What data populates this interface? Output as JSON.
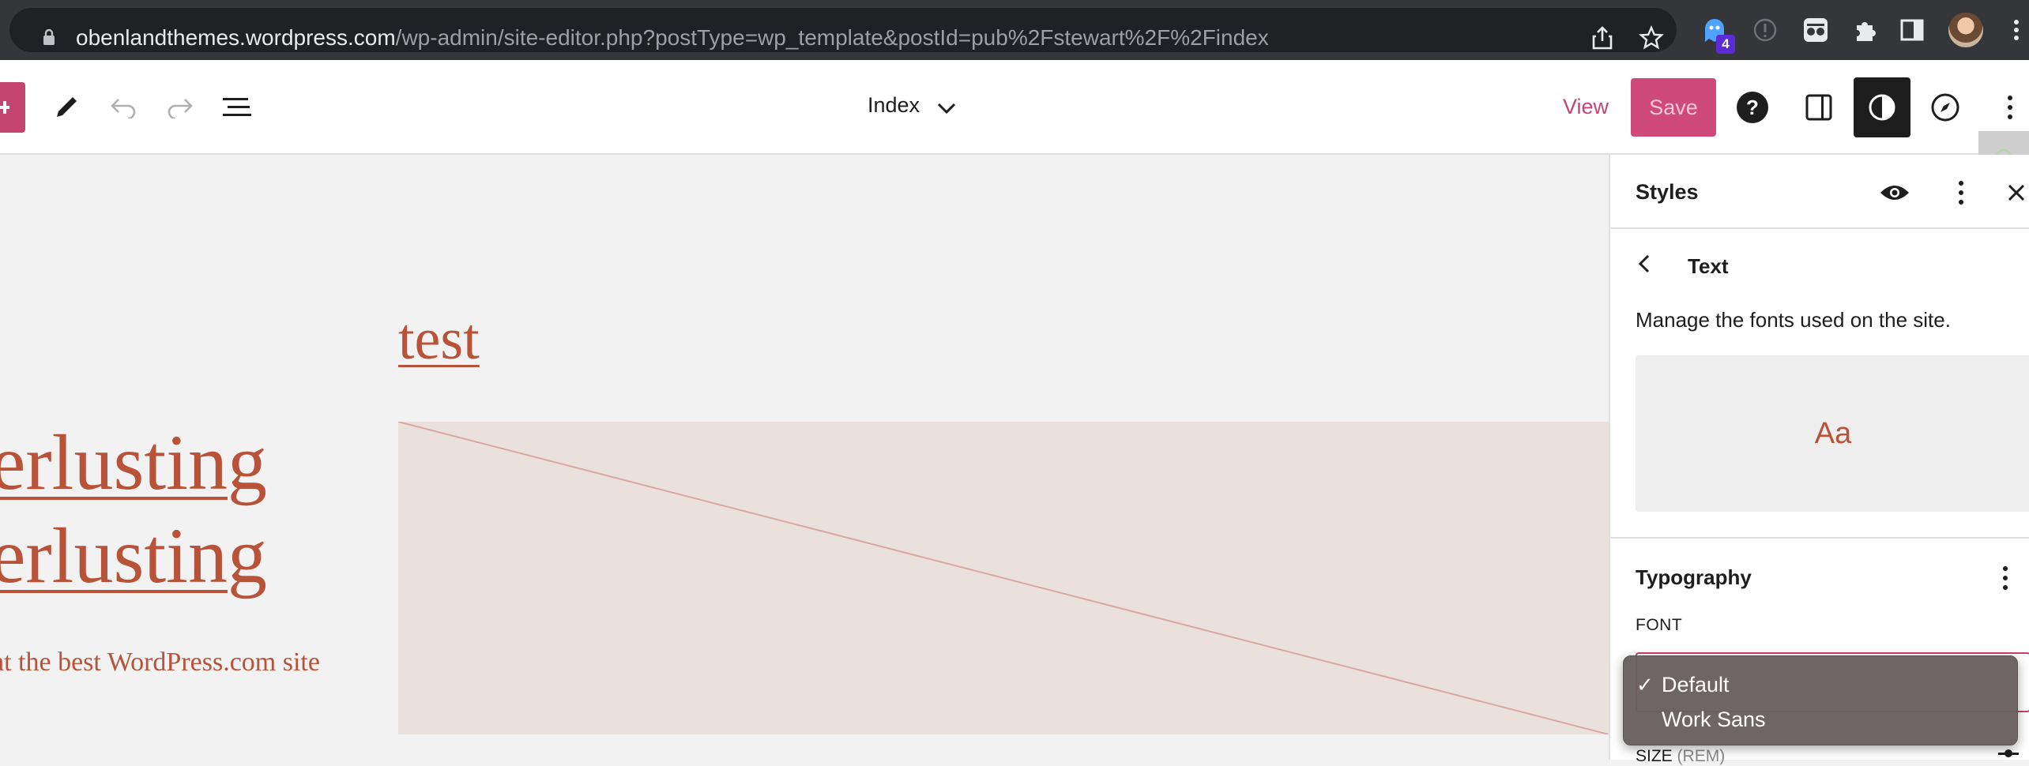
{
  "browser": {
    "url_host": "obenlandthemes.wordpress.com",
    "url_path": "/wp-admin/site-editor.php?postType=wp_template&postId=pub%2Fstewart%2F%2Findex",
    "extension_badge": "4"
  },
  "toolbar": {
    "template_title": "Index",
    "view_label": "View",
    "save_label": "Save",
    "accent_color": "#c3446f"
  },
  "canvas": {
    "post_title": "test",
    "site_title_lines": [
      "derlusting",
      "derlusting"
    ],
    "tagline": "at the best WordPress.com site",
    "text_color": "#b8533a",
    "placeholder_color": "#eae0dc"
  },
  "styles_panel": {
    "title": "Styles",
    "nav_title": "Text",
    "description": "Manage the fonts used on the site.",
    "preview_text": "Aa",
    "typography_title": "Typography",
    "font_label": "FONT",
    "size_label": "SIZE",
    "size_unit": "(REM)"
  },
  "font_dropdown": {
    "options": [
      {
        "label": "Default",
        "selected": true
      },
      {
        "label": "Work Sans",
        "selected": false
      }
    ],
    "check_mark": "✓"
  }
}
